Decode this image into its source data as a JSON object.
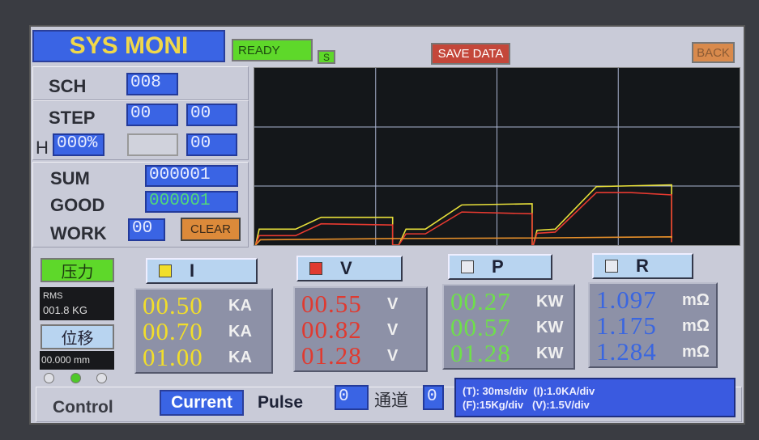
{
  "header": {
    "title": "SYS MONI",
    "status": "READY",
    "s_badge": "S",
    "save_label": "SAVE DATA",
    "back_label": "BACK"
  },
  "left": {
    "sch_label": "SCH",
    "sch_value": "008",
    "step_label": "STEP",
    "step_value_1": "00",
    "step_value_2": "00",
    "h_label": "H",
    "h_value": "000%",
    "h_value_2": "",
    "h_value_3": "00",
    "sum_label": "SUM",
    "sum_value": "000001",
    "good_label": "GOOD",
    "good_value": "000001",
    "work_label": "WORK",
    "work_value": "00",
    "clear_label": "CLEAR"
  },
  "sensors": {
    "pressure_label": "压力",
    "rms_label": "RMS",
    "rms_value": "001.8 KG",
    "displacement_label": "位移",
    "displacement_value": "00.000 mm",
    "indicators": [
      false,
      true,
      false
    ]
  },
  "channels": [
    {
      "label": "I",
      "color": "#f2de2a",
      "values": [
        "00.50",
        "00.70",
        "01.00"
      ],
      "unit": "KA",
      "selected": true
    },
    {
      "label": "V",
      "color": "#e03a30",
      "values": [
        "00.55",
        "00.82",
        "01.28"
      ],
      "unit": "V",
      "selected": true
    },
    {
      "label": "P",
      "color": "#6ee04a",
      "values": [
        "00.27",
        "00.57",
        "01.28"
      ],
      "unit": "KW",
      "selected": false
    },
    {
      "label": "R",
      "color": "#3a66e0",
      "values": [
        "1.097",
        "1.175",
        "1.284"
      ],
      "unit": "mΩ",
      "selected": false
    }
  ],
  "control": {
    "label": "Control",
    "current_label": "Current",
    "pulse_label": "Pulse",
    "pulse_value": "0",
    "channel_label": "通道",
    "channel_value": "0",
    "scale_t": "(T): 30ms/div",
    "scale_i": "(I):1.0KA/div",
    "scale_f": "(F):15Kg/div",
    "scale_v": "(V):1.5V/div"
  },
  "chart_data": {
    "type": "line",
    "x_divisions": 4,
    "y_divisions": 3,
    "grid": true,
    "series": [
      {
        "name": "I",
        "color": "#e8e03a",
        "points": [
          [
            0.01,
            0
          ],
          [
            0.04,
            0.27
          ],
          [
            0.34,
            0.27
          ],
          [
            0.55,
            0.47
          ],
          [
            1.14,
            0.47
          ],
          [
            1.14,
            0
          ],
          [
            1.19,
            0
          ],
          [
            1.25,
            0.27
          ],
          [
            1.41,
            0.27
          ],
          [
            1.71,
            0.68
          ],
          [
            2.29,
            0.7
          ],
          [
            2.29,
            0
          ],
          [
            2.3,
            0
          ],
          [
            2.33,
            0.25
          ],
          [
            2.48,
            0.27
          ],
          [
            2.82,
            0.99
          ],
          [
            3.44,
            1.02
          ],
          [
            3.44,
            0.05
          ]
        ]
      },
      {
        "name": "V",
        "color": "#e83a30",
        "points": [
          [
            0.01,
            0
          ],
          [
            0.04,
            0.16
          ],
          [
            0.34,
            0.16
          ],
          [
            0.55,
            0.36
          ],
          [
            1.14,
            0.34
          ],
          [
            1.14,
            0
          ],
          [
            1.19,
            0
          ],
          [
            1.25,
            0.19
          ],
          [
            1.41,
            0.19
          ],
          [
            1.71,
            0.56
          ],
          [
            2.29,
            0.53
          ],
          [
            2.29,
            0
          ],
          [
            2.3,
            0
          ],
          [
            2.33,
            0.2
          ],
          [
            2.48,
            0.22
          ],
          [
            2.82,
            0.89
          ],
          [
            3.1,
            0.89
          ],
          [
            3.44,
            0.85
          ],
          [
            3.44,
            0.05
          ]
        ]
      },
      {
        "name": "F",
        "color": "#e8902a",
        "points": [
          [
            0.01,
            0
          ],
          [
            0.05,
            0.09
          ],
          [
            1.14,
            0.11
          ],
          [
            2.3,
            0.12
          ],
          [
            3.44,
            0.14
          ],
          [
            3.44,
            0.12
          ]
        ]
      }
    ]
  }
}
